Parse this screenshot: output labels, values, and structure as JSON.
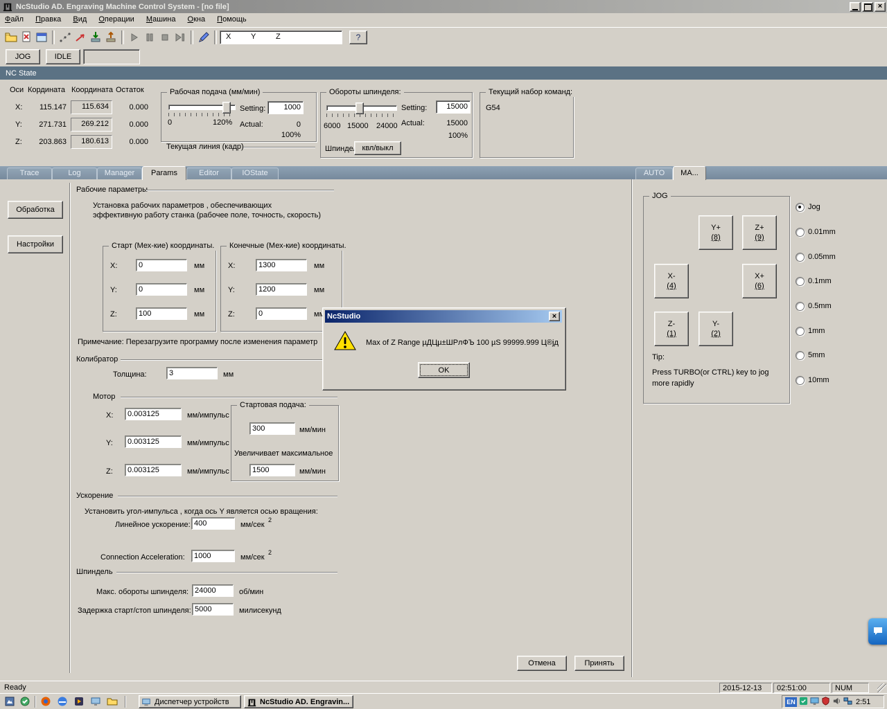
{
  "window": {
    "title": "NcStudio AD. Engraving Machine Control System  - [no file]"
  },
  "menu": {
    "items": [
      "Файл",
      "Правка",
      "Вид",
      "Операции",
      "Машина",
      "Окна",
      "Помощь"
    ]
  },
  "toolbar": {
    "x": "X",
    "y": "Y",
    "z": "Z",
    "help": "?"
  },
  "mode": {
    "jog": "JOG",
    "idle": "IDLE"
  },
  "nc": {
    "header": "NC State",
    "table": {
      "headers": [
        "Оси",
        "Кордината",
        "Координата",
        "Остаток"
      ],
      "rows": [
        {
          "axis": "X:",
          "v1": "115.147",
          "v2": "115.634",
          "v3": "0.000"
        },
        {
          "axis": "Y:",
          "v1": "271.731",
          "v2": "269.212",
          "v3": "0.000"
        },
        {
          "axis": "Z:",
          "v1": "203.863",
          "v2": "180.613",
          "v3": "0.000"
        }
      ]
    },
    "feed": {
      "title": "Рабочая подача (мм/мин)",
      "zero": "0",
      "max": "120%",
      "setting_label": "Setting:",
      "setting": "1000",
      "actual_label": "Actual:",
      "actual": "0",
      "percent": "100%",
      "current_line": "Текущая линия (кадр)"
    },
    "spindle": {
      "title": "Обороты шпинделя:",
      "ticks": [
        "6000",
        "15000",
        "24000"
      ],
      "setting_label": "Setting:",
      "setting": "15000",
      "actual_label": "Actual:",
      "actual": "15000",
      "percent": "100%",
      "label": "Шпиндел",
      "toggle": "квл/выкл"
    },
    "cmd": {
      "title": "Текущий набор команд:",
      "value": "G54"
    }
  },
  "tabs": {
    "left": [
      "Trace",
      "Log",
      "Manager",
      "Params",
      "Editor",
      "IOState"
    ],
    "active_left": "Params",
    "right": [
      "AUTO",
      "MA..."
    ],
    "active_right": "MA..."
  },
  "sidebar": {
    "items": [
      "Обработка",
      "Настройки"
    ]
  },
  "p": {
    "title": "Рабочие параметры",
    "desc1": "Установка рабочих параметров , обеспечивающих",
    "desc2": "эффективную работу станка (рабочее поле, точность, скорость)",
    "start": {
      "title": "Старт (Мех-кие) координаты.",
      "rows": [
        {
          "label": "X:",
          "value": "0",
          "unit": "мм"
        },
        {
          "label": "Y:",
          "value": "0",
          "unit": "мм"
        },
        {
          "label": "Z:",
          "value": "100",
          "unit": "мм"
        }
      ]
    },
    "end": {
      "title": "Конечные (Мех-кие) координаты.",
      "rows": [
        {
          "label": "X:",
          "value": "1300",
          "unit": "мм"
        },
        {
          "label": "Y:",
          "value": "1200",
          "unit": "мм"
        },
        {
          "label": "Z:",
          "value": "0",
          "unit": "мм"
        }
      ]
    },
    "note": "Примечание: Перезагрузите программу после  изменения  параметр",
    "cal": {
      "title": "Колибратор",
      "label": "Толщина:",
      "value": "3",
      "unit": "мм"
    },
    "motor": {
      "title": "Мотор",
      "rows": [
        {
          "label": "X:",
          "value": "0.003125",
          "unit": "мм/импульс"
        },
        {
          "label": "Y:",
          "value": "0.003125",
          "unit": "мм/импульс"
        },
        {
          "label": "Z:",
          "value": "0.003125",
          "unit": "мм/импульс"
        }
      ]
    },
    "feed2": {
      "title": "Стартовая подача:",
      "value1": "300",
      "unit1": "мм/мин",
      "text": "Увеличивает максимальное",
      "value2": "1500",
      "unit2": "мм/мин"
    },
    "acc": {
      "title": "Ускорение",
      "note": "Установить угол-импульса , когда ось Y является осью вращения:",
      "l1": "Линейное ускорение:",
      "v1": "400",
      "u1": "мм/сек",
      "s1": "2",
      "l2": "Connection Acceleration:",
      "v2": "1000",
      "u2": "мм/сек",
      "s2": "2"
    },
    "sp": {
      "title": "Шпиндель",
      "l1": "Макс. обороты шпинделя:",
      "v1": "24000",
      "u1": "об/мин",
      "l2": "Задержка старт/стоп шпинделя:",
      "v2": "5000",
      "u2": "милисекунд"
    },
    "cancel": "Отмена",
    "apply": "Принять"
  },
  "jog": {
    "title": "JOG",
    "buttons": [
      {
        "label": "Y+",
        "key": "(8)"
      },
      {
        "label": "Z+",
        "key": "(9)"
      },
      {
        "label": "X-",
        "key": "(4)"
      },
      {
        "label": "X+",
        "key": "(6)"
      },
      {
        "label": "Z-",
        "key": "(1)"
      },
      {
        "label": "Y-",
        "key": "(2)"
      }
    ],
    "radios": [
      {
        "label": "Jog",
        "selected": true
      },
      {
        "label": "0.01mm",
        "selected": false
      },
      {
        "label": "0.05mm",
        "selected": false
      },
      {
        "label": "0.1mm",
        "selected": false
      },
      {
        "label": "0.5mm",
        "selected": false
      },
      {
        "label": "1mm",
        "selected": false
      },
      {
        "label": "5mm",
        "selected": false
      },
      {
        "label": "10mm",
        "selected": false
      }
    ],
    "tip1": "Tip:",
    "tip2": "Press TURBO(or CTRL) key to jog",
    "tip3": "more rapidly"
  },
  "dlg": {
    "title": "NcStudio",
    "message": "Max of Z Range µДЦµ±ШРлФЪ 100 µЅ 99999.999 Ц®јд",
    "ok": "OK"
  },
  "status": {
    "ready": "Ready",
    "date": "2015-12-13",
    "time": "02:51:00",
    "num": "NUM"
  },
  "task": {
    "buttons": [
      "Диспетчер устройств",
      "NcStudio AD. Engravin..."
    ],
    "lang": "EN",
    "time": "2:51"
  }
}
